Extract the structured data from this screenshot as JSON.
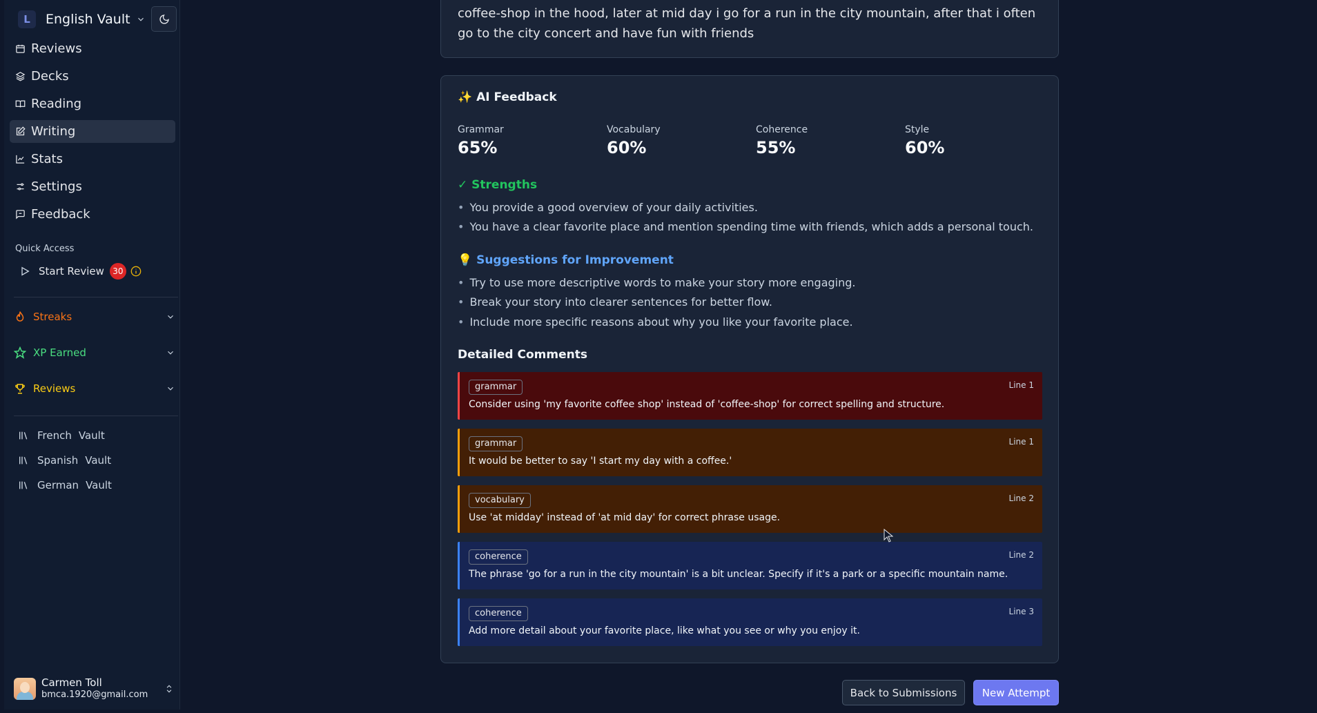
{
  "sidebar": {
    "brand_letter": "L",
    "brand_name": "English Vault",
    "nav": [
      {
        "label": "Reviews",
        "icon": "calendar-icon",
        "active": false
      },
      {
        "label": "Decks",
        "icon": "layers-icon",
        "active": false
      },
      {
        "label": "Reading",
        "icon": "book-open-icon",
        "active": false
      },
      {
        "label": "Writing",
        "icon": "pencil-square-icon",
        "active": true
      },
      {
        "label": "Stats",
        "icon": "chart-line-icon",
        "active": false
      },
      {
        "label": "Settings",
        "icon": "sliders-icon",
        "active": false
      },
      {
        "label": "Feedback",
        "icon": "message-square-icon",
        "active": false
      }
    ],
    "quick_access": {
      "title": "Quick Access",
      "start_review": "Start Review",
      "count": "30"
    },
    "groups": [
      {
        "label": "Streaks",
        "icon": "flame-icon",
        "color": "#f97316"
      },
      {
        "label": "XP Earned",
        "icon": "star-icon",
        "color": "#4ade80"
      },
      {
        "label": "Reviews",
        "icon": "trophy-icon",
        "color": "#facc15"
      }
    ],
    "vaults": [
      {
        "word1": "French",
        "word2": "Vault"
      },
      {
        "word1": "Spanish",
        "word2": "Vault"
      },
      {
        "word1": "German",
        "word2": "Vault"
      }
    ],
    "user": {
      "name": "Carmen Toll",
      "email": "bmca.1920@gmail.com"
    }
  },
  "essay": {
    "text": "coffee-shop in the hood, later at mid day i go for a run in the city mountain, after that i often go to the city concert and have fun with friends"
  },
  "feedback": {
    "title": "✨ AI Feedback",
    "scores": [
      {
        "label": "Grammar",
        "value": "65%"
      },
      {
        "label": "Vocabulary",
        "value": "60%"
      },
      {
        "label": "Coherence",
        "value": "55%"
      },
      {
        "label": "Style",
        "value": "60%"
      }
    ],
    "strengths_title": "✓ Strengths",
    "strengths": [
      "You provide a good overview of your daily activities.",
      "You have a clear favorite place and mention spending time with friends, which adds a personal touch."
    ],
    "suggestions_title": "💡 Suggestions for Improvement",
    "suggestions": [
      "Try to use more descriptive words to make your story more engaging.",
      "Break your story into clearer sentences for better flow.",
      "Include more specific reasons about why you like your favorite place."
    ],
    "detailed_title": "Detailed Comments",
    "comments": [
      {
        "tag": "grammar",
        "line": "Line 1",
        "text": "Consider using 'my favorite coffee shop' instead of 'coffee-shop' for correct spelling and structure.",
        "kind": "red"
      },
      {
        "tag": "grammar",
        "line": "Line 1",
        "text": "It would be better to say 'I start my day with a coffee.'",
        "kind": "orange"
      },
      {
        "tag": "vocabulary",
        "line": "Line 2",
        "text": "Use 'at midday' instead of 'at mid day' for correct phrase usage.",
        "kind": "orange"
      },
      {
        "tag": "coherence",
        "line": "Line 2",
        "text": "The phrase 'go for a run in the city mountain' is a bit unclear. Specify if it's a park or a specific mountain name.",
        "kind": "blue"
      },
      {
        "tag": "coherence",
        "line": "Line 3",
        "text": "Add more detail about your favorite place, like what you see or why you enjoy it.",
        "kind": "blue"
      }
    ]
  },
  "actions": {
    "back": "Back to Submissions",
    "new_attempt": "New Attempt"
  },
  "colors": {
    "strengths": "#22c55e",
    "suggestions": "#60a5fa",
    "accent": "#6d78f0"
  }
}
